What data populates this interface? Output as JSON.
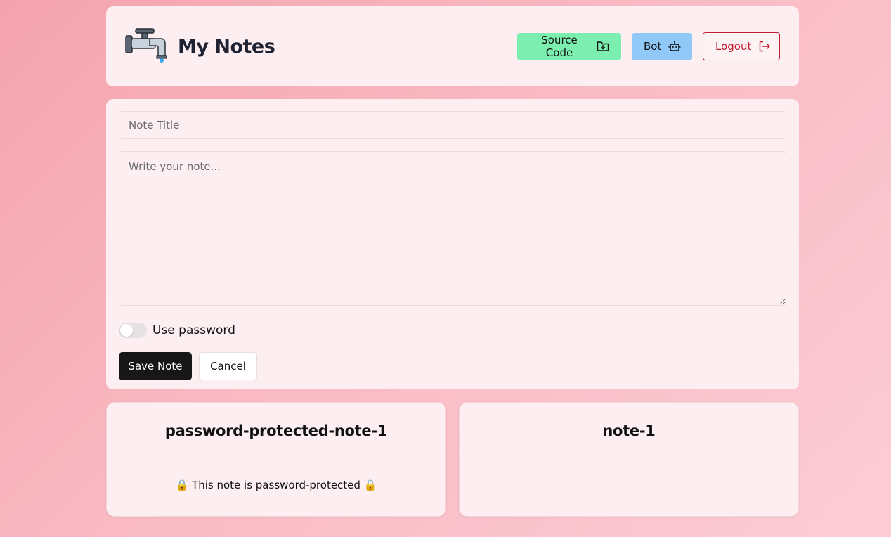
{
  "header": {
    "title": "My Notes",
    "logo_icon": "faucet-icon",
    "buttons": {
      "source_code": "Source Code",
      "bot": "Bot",
      "logout": "Logout"
    }
  },
  "editor": {
    "title_placeholder": "Note Title",
    "body_placeholder": "Write your note...",
    "password_label": "Use password",
    "password_enabled": false,
    "save_label": "Save Note",
    "cancel_label": "Cancel"
  },
  "notes": [
    {
      "title": "password-protected-note-1",
      "body": "🔒 This note is password-protected 🔒",
      "locked": true
    },
    {
      "title": "note-1",
      "body": "",
      "locked": false
    }
  ],
  "colors": {
    "source_button": "#7cefb0",
    "bot_button": "#90c8f8",
    "logout_accent": "#c41c2e",
    "save_button": "#171717",
    "card_bg": "#fdeff1"
  }
}
